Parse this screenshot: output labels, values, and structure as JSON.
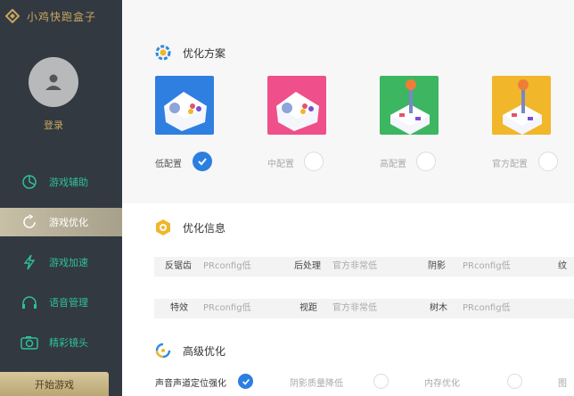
{
  "sidebar": {
    "app_title": "小鸡快跑盒子",
    "login": "登录",
    "items": [
      {
        "label": "游戏辅助",
        "icon": "pie-icon"
      },
      {
        "label": "游戏优化",
        "icon": "refresh-icon"
      },
      {
        "label": "游戏加速",
        "icon": "lightning-icon"
      },
      {
        "label": "语音管理",
        "icon": "headset-icon"
      },
      {
        "label": "精彩镜头",
        "icon": "camera-icon"
      }
    ],
    "start_button": "开始游戏"
  },
  "optimization_plan": {
    "title": "优化方案",
    "options": [
      {
        "label": "低配置",
        "selected": true,
        "color": "#2f7fe0"
      },
      {
        "label": "中配置",
        "selected": false,
        "color": "#ef4f8a"
      },
      {
        "label": "高配置",
        "selected": false,
        "color": "#3cb661"
      },
      {
        "label": "官方配置",
        "selected": false,
        "color": "#f1b62a"
      }
    ]
  },
  "optimization_info": {
    "title": "优化信息",
    "rows": [
      [
        {
          "key": "反锯齿",
          "value": "PRconfig低"
        },
        {
          "key": "后处理",
          "value": "官方非常低"
        },
        {
          "key": "阴影",
          "value": "PRconfig低"
        },
        {
          "key": "纹"
        }
      ],
      [
        {
          "key": "特效",
          "value": "PRconfig低"
        },
        {
          "key": "视距",
          "value": "官方非常低"
        },
        {
          "key": "树木",
          "value": "PRconfig低"
        }
      ]
    ]
  },
  "advanced": {
    "title": "高级优化",
    "options": [
      {
        "label": "声音声道定位强化",
        "selected": true
      },
      {
        "label": "阴影质量降低",
        "selected": false
      },
      {
        "label": "内存优化",
        "selected": false
      },
      {
        "label": "图"
      }
    ]
  }
}
